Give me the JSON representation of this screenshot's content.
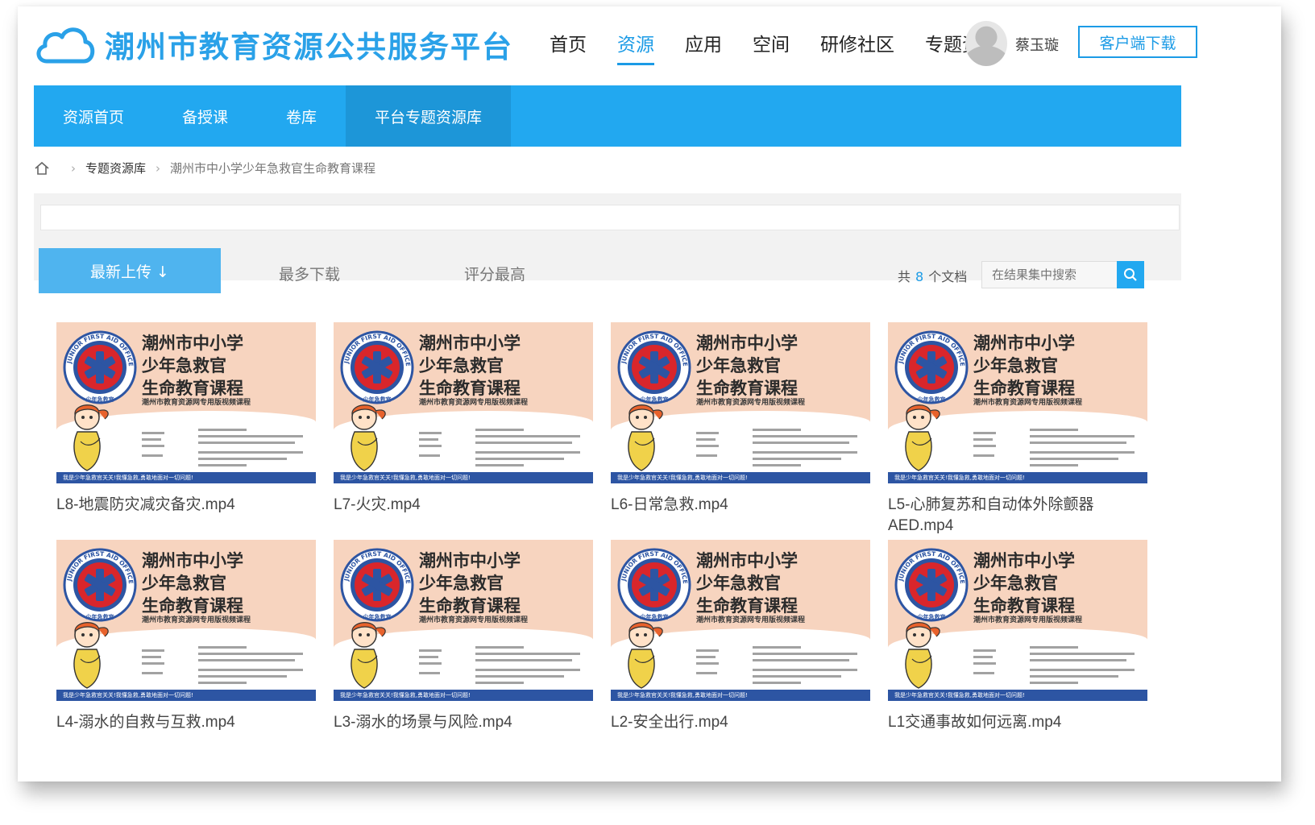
{
  "header": {
    "logo_text": "潮州市教育资源公共服务平台",
    "nav": [
      "首页",
      "资源",
      "应用",
      "空间",
      "研修社区",
      "专题资"
    ],
    "active_nav": 1,
    "user_name": "蔡玉璇",
    "download_label": "客户端下载"
  },
  "subnav": {
    "items": [
      "资源首页",
      "备授课",
      "卷库",
      "平台专题资源库"
    ],
    "active": 3
  },
  "breadcrumb": {
    "items": [
      "专题资源库",
      "潮州市中小学少年急救官生命教育课程"
    ]
  },
  "sort": {
    "tabs": [
      "最新上传 ↓",
      "最多下载",
      "评分最高"
    ],
    "active": 0
  },
  "count": {
    "prefix": "共",
    "value": "8",
    "suffix": "个文档"
  },
  "search": {
    "placeholder": "在结果集中搜索"
  },
  "thumbnail": {
    "title_lines": [
      "潮州市中小学",
      "少年急救官",
      "生命教育课程"
    ],
    "subtitle": "潮州市教育资源网专用版视频课程",
    "badge_text": "JUNIOR FIRST AID OFFICER",
    "badge_cn": "少年急救官",
    "footer": "我是少年急救官关关!我懂急救,勇敢地面对一切问题!"
  },
  "files": [
    "L8-地震防灾减灾备灾.mp4",
    "L7-火灾.mp4",
    "L6-日常急救.mp4",
    "L5-心肺复苏和自动体外除颤器AED.mp4",
    "L4-溺水的自救与互救.mp4",
    "L3-溺水的场景与风险.mp4",
    "L2-安全出行.mp4",
    "L1交通事故如何远离.mp4"
  ],
  "colors": {
    "brand_blue": "#22a8f0",
    "link_blue": "#1b9be6",
    "thumb_peach": "#f7d4bf",
    "badge_red": "#d9262b",
    "footer_navy": "#2d55a3"
  }
}
